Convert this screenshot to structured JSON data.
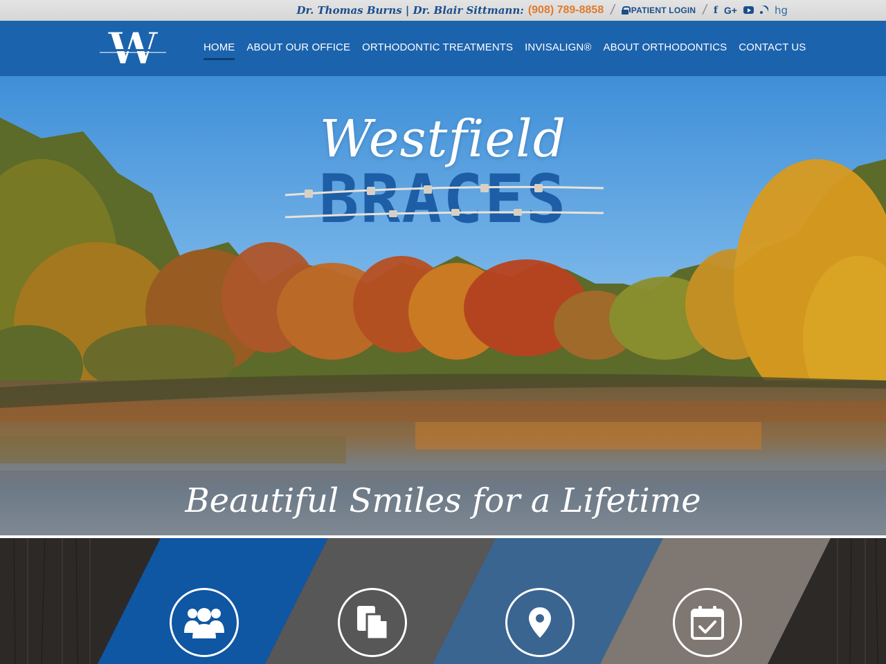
{
  "topbar": {
    "doctors": "Dr. Thomas Burns | Dr. Blair Sittmann:",
    "phone": "(908) 789-8858",
    "login_label": "PATIENT LOGIN",
    "social": {
      "facebook": "f",
      "googleplus": "G+",
      "hg": "hg"
    }
  },
  "nav": {
    "logo_letter": "W",
    "items": [
      {
        "label": "HOME",
        "active": true
      },
      {
        "label": "ABOUT OUR OFFICE"
      },
      {
        "label": "ORTHODONTIC TREATMENTS"
      },
      {
        "label": "INVISALIGN®"
      },
      {
        "label": "ABOUT ORTHODONTICS"
      },
      {
        "label": "CONTACT US"
      }
    ]
  },
  "hero": {
    "title_script": "Westfield",
    "title_block": "BRACES",
    "tagline": "Beautiful Smiles for a Lifetime"
  },
  "features": [
    {
      "icon": "group-icon",
      "color": "#0f56a3"
    },
    {
      "icon": "documents-icon",
      "color": "#575757"
    },
    {
      "icon": "map-pin-icon",
      "color": "#3b6591"
    },
    {
      "icon": "calendar-check-icon",
      "color": "#7f7772"
    }
  ],
  "colors": {
    "nav_blue": "#1c63ad",
    "phone_orange": "#e07a2e",
    "brand_dark_blue": "#1a4e8c"
  }
}
